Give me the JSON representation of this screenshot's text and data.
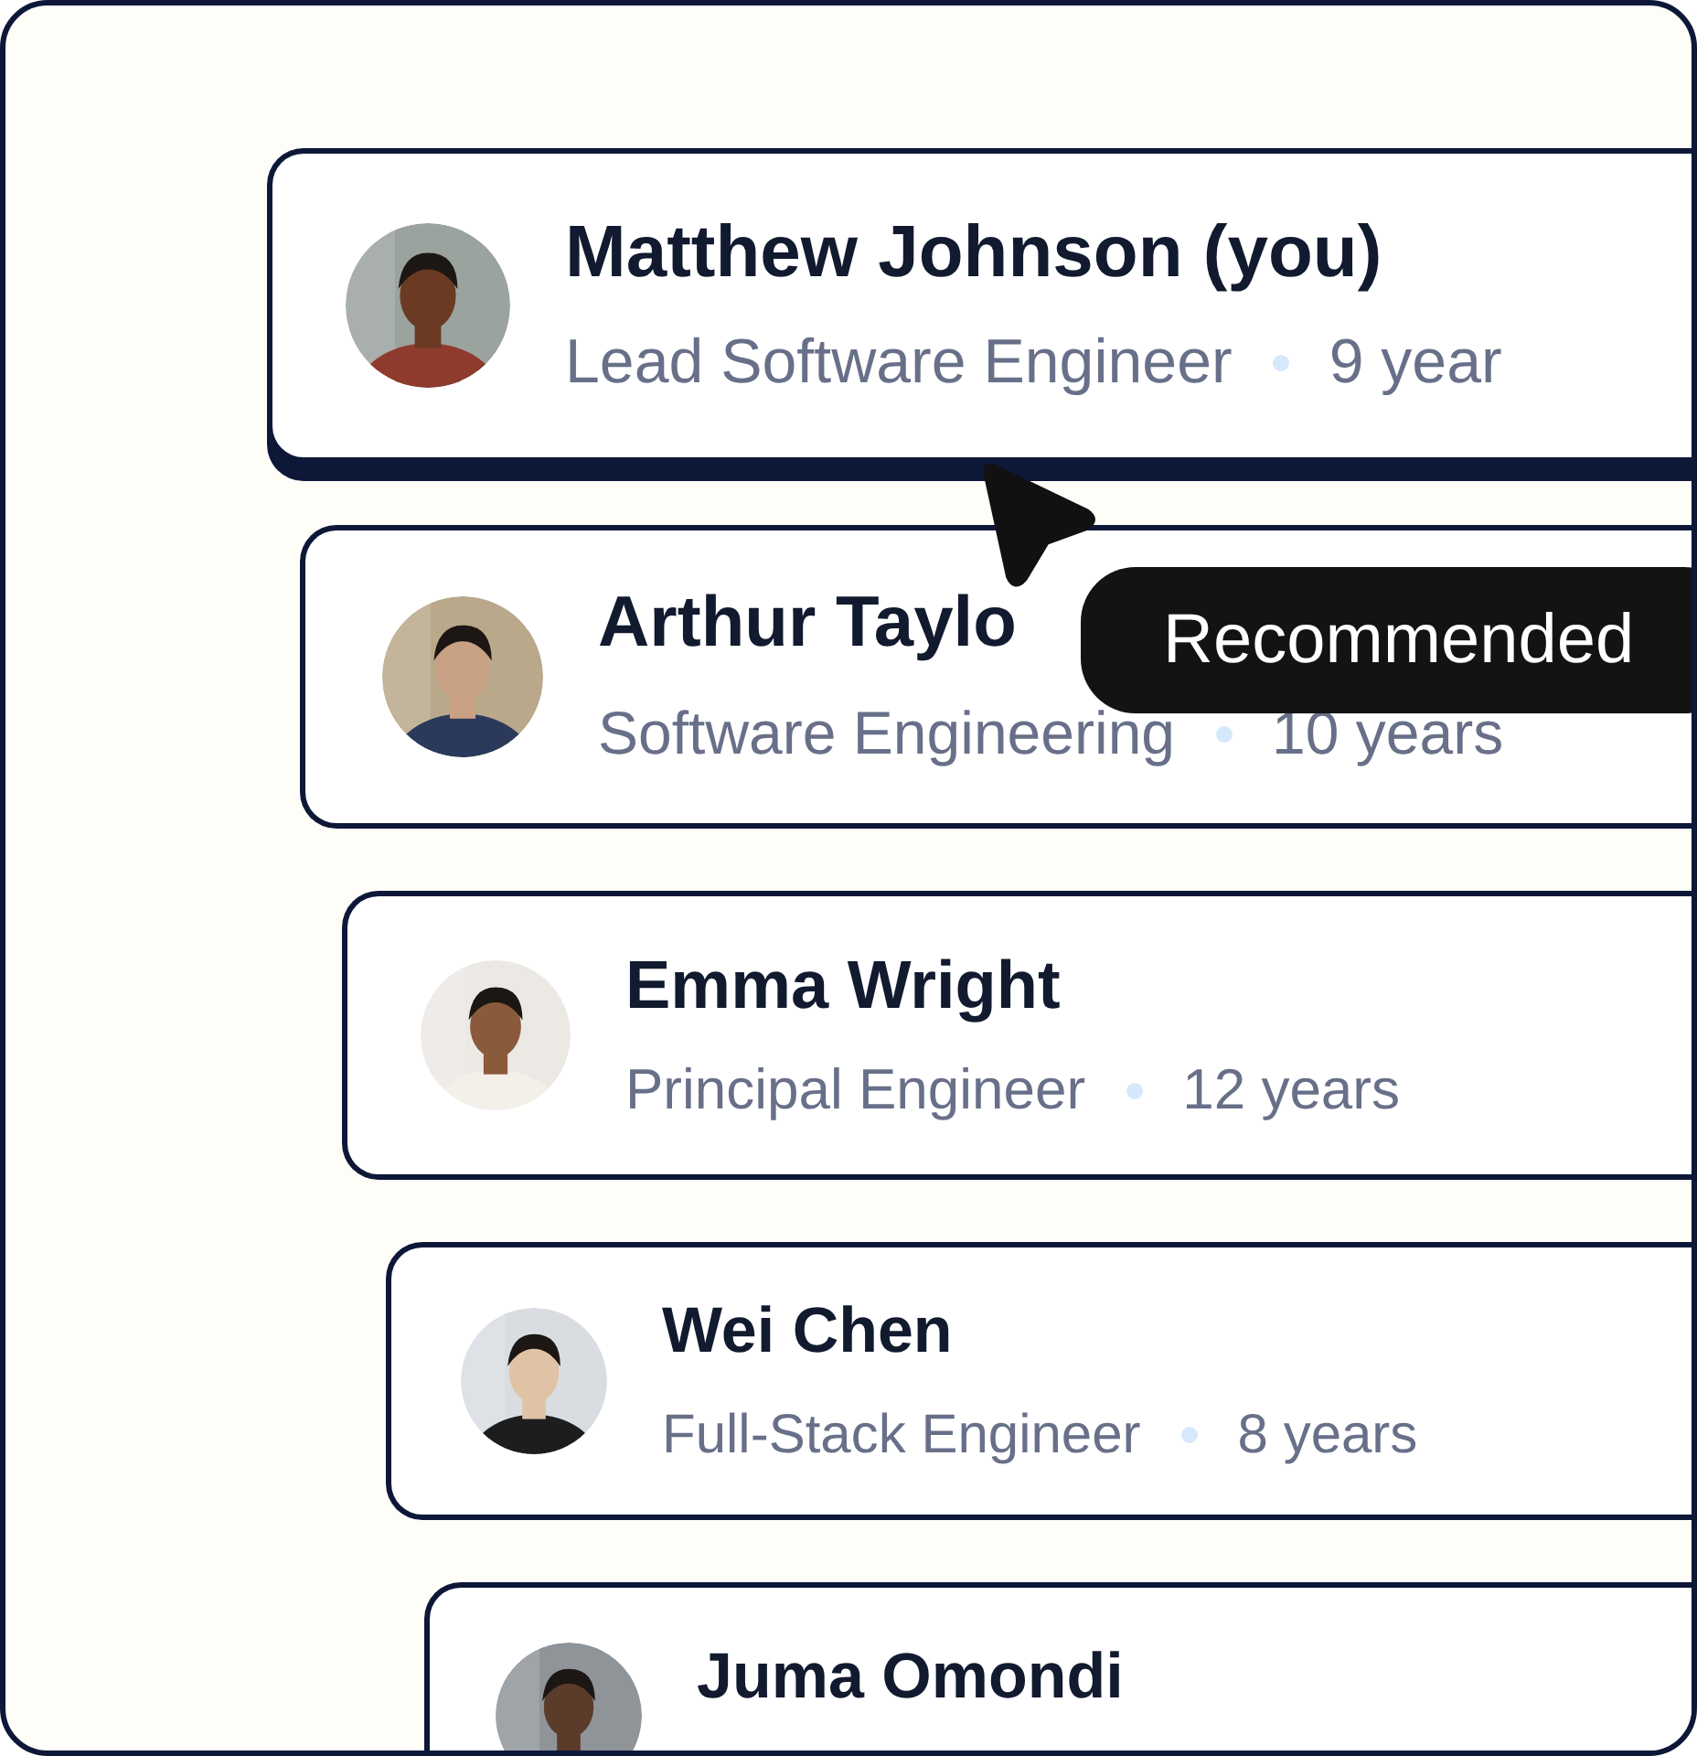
{
  "people": [
    {
      "name": "Matthew Johnson (you)",
      "role": "Lead Software Engineer",
      "years": "9 year",
      "selected": true
    },
    {
      "name": "Arthur Taylo",
      "role": "Software Engineering",
      "years": "10 years",
      "selected": false
    },
    {
      "name": "Emma Wright",
      "role": "Principal Engineer",
      "years": "12 years",
      "selected": false
    },
    {
      "name": "Wei Chen",
      "role": "Full-Stack Engineer",
      "years": "8 years",
      "selected": false
    },
    {
      "name": "Juma Omondi"
    }
  ],
  "tooltip": {
    "text": "Recommended"
  }
}
